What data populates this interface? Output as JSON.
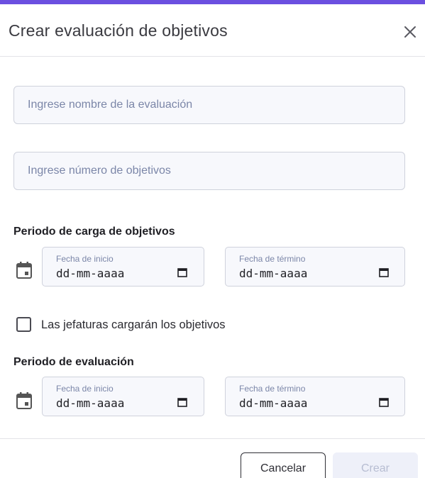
{
  "dialog": {
    "title": "Crear evaluación de objetivos",
    "accent_color": "#6b4fe0"
  },
  "form": {
    "evaluation_name": {
      "value": "",
      "placeholder": "Ingrese nombre de la evaluación"
    },
    "objectives_count": {
      "value": "",
      "placeholder": "Ingrese número de objetivos"
    }
  },
  "load_period": {
    "title": "Periodo de carga de objetivos",
    "start": {
      "label": "Fecha de inicio",
      "value": "dd-mm-aaaa"
    },
    "end": {
      "label": "Fecha de término",
      "value": "dd-mm-aaaa"
    }
  },
  "managers_checkbox": {
    "label": "Las jefaturas cargarán los objetivos",
    "checked": false
  },
  "evaluation_period": {
    "title": "Periodo de evaluación",
    "start": {
      "label": "Fecha de inicio",
      "value": "dd-mm-aaaa"
    },
    "end": {
      "label": "Fecha de término",
      "value": "dd-mm-aaaa"
    }
  },
  "footer": {
    "cancel_label": "Cancelar",
    "create_label": "Crear",
    "create_disabled": true
  }
}
